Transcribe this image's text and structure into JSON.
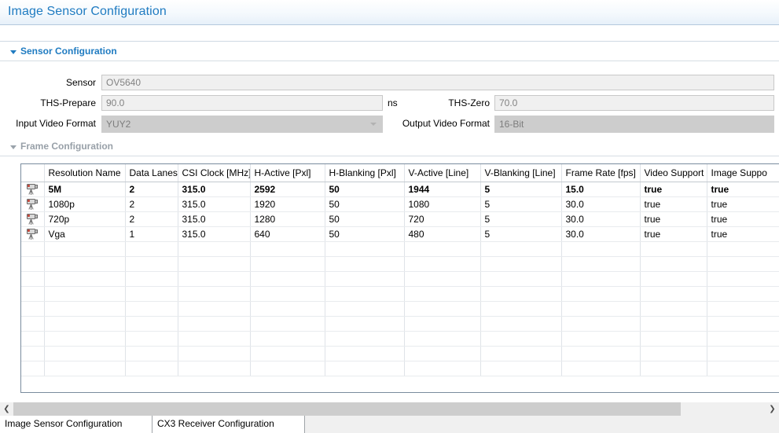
{
  "window": {
    "title": "Image Sensor Configuration"
  },
  "sections": {
    "sensor": {
      "label": "Sensor Configuration",
      "expanded_icon": "triangle-down-icon"
    },
    "frame": {
      "label": "Frame Configuration",
      "expanded_icon": "triangle-down-icon"
    }
  },
  "sensor_form": {
    "sensor": {
      "label": "Sensor",
      "value": "OV5640"
    },
    "ths_prepare": {
      "label": "THS-Prepare",
      "value": "90.0",
      "unit": "ns"
    },
    "ths_zero": {
      "label": "THS-Zero",
      "value": "70.0"
    },
    "input_video_format": {
      "label": "Input Video Format",
      "value": "YUY2"
    },
    "output_video_format": {
      "label": "Output Video Format",
      "value": "16-Bit"
    }
  },
  "frame_table": {
    "columns": [
      "Resolution Name",
      "Data Lanes",
      "CSI Clock [MHz]",
      "H-Active [Pxl]",
      "H-Blanking [Pxl]",
      "V-Active [Line]",
      "V-Blanking [Line]",
      "Frame Rate [fps]",
      "Video Support",
      "Image Suppo"
    ],
    "rows": [
      {
        "icon": "video-camera-icon",
        "selected": true,
        "cells": [
          "5M",
          "2",
          "315.0",
          "2592",
          "50",
          "1944",
          "5",
          "15.0",
          "true",
          "true"
        ]
      },
      {
        "icon": "video-camera-icon",
        "selected": false,
        "cells": [
          "1080p",
          "2",
          "315.0",
          "1920",
          "50",
          "1080",
          "5",
          "30.0",
          "true",
          "true"
        ]
      },
      {
        "icon": "video-camera-icon",
        "selected": false,
        "cells": [
          "720p",
          "2",
          "315.0",
          "1280",
          "50",
          "720",
          "5",
          "30.0",
          "true",
          "true"
        ]
      },
      {
        "icon": "video-camera-icon",
        "selected": false,
        "cells": [
          "Vga",
          "1",
          "315.0",
          "640",
          "50",
          "480",
          "5",
          "30.0",
          "true",
          "true"
        ]
      }
    ],
    "empty_row_count": 9
  },
  "scrollbar": {
    "left_arrow": "❮",
    "right_arrow": "❯"
  },
  "tabs": [
    {
      "label": "Image Sensor Configuration",
      "active": true
    },
    {
      "label": "CX3 Receiver Configuration",
      "active": false
    }
  ]
}
